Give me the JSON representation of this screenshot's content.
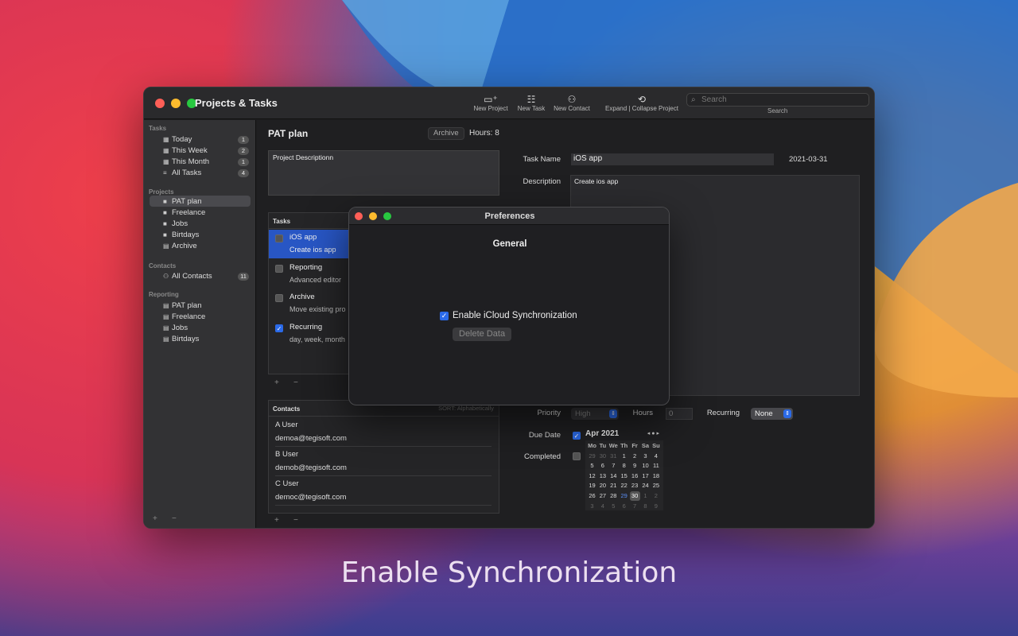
{
  "window": {
    "title": "Projects & Tasks"
  },
  "toolbar": {
    "new_project": "New Project",
    "new_task": "New Task",
    "new_contact": "New Contact",
    "expand_collapse": "Expand | Collapse Project",
    "search_placeholder": "Search",
    "search_label": "Search"
  },
  "sidebar": {
    "tasks_header": "Tasks",
    "tasks": [
      {
        "label": "Today",
        "count": "1"
      },
      {
        "label": "This Week",
        "count": "2"
      },
      {
        "label": "This Month",
        "count": "1"
      },
      {
        "label": "All Tasks",
        "count": "4"
      }
    ],
    "projects_header": "Projects",
    "projects": [
      {
        "label": "PAT plan"
      },
      {
        "label": "Freelance"
      },
      {
        "label": "Jobs"
      },
      {
        "label": "Birtdays"
      },
      {
        "label": "Archive"
      }
    ],
    "contacts_header": "Contacts",
    "contacts": [
      {
        "label": "All Contacts",
        "count": "11"
      }
    ],
    "reporting_header": "Reporting",
    "reporting": [
      {
        "label": "PAT plan"
      },
      {
        "label": "Freelance"
      },
      {
        "label": "Jobs"
      },
      {
        "label": "Birtdays"
      }
    ],
    "add": "+",
    "remove": "−"
  },
  "project": {
    "title": "PAT plan",
    "archive_button": "Archive",
    "hours": "Hours: 8",
    "description": "Project Descriptionn"
  },
  "tasks_panel": {
    "header": "Tasks",
    "items": [
      {
        "name": "iOS app",
        "sub": "Create ios app",
        "checked": false
      },
      {
        "name": "Reporting",
        "sub": "Advanced editor",
        "checked": false
      },
      {
        "name": "Archive",
        "sub": "Move existing pro",
        "checked": false
      },
      {
        "name": "Recurring",
        "sub": "day, week, month",
        "checked": true
      }
    ],
    "add": "+",
    "remove": "−"
  },
  "contacts_panel": {
    "header": "Contacts",
    "sort": "SORT: Alphabetically",
    "items": [
      {
        "name": "A User",
        "email": "demoa@tegisoft.com"
      },
      {
        "name": "B User",
        "email": "demob@tegisoft.com"
      },
      {
        "name": "C User",
        "email": "democ@tegisoft.com"
      }
    ],
    "add": "+",
    "remove": "−"
  },
  "task_detail": {
    "task_name_label": "Task Name",
    "task_name": "iOS app",
    "date": "2021-03-31",
    "description_label": "Description",
    "description": "Create ios app",
    "priority_label": "Priority",
    "priority": "High",
    "hours_label": "Hours",
    "hours": "0",
    "recurring_label": "Recurring",
    "recurring": "None",
    "due_date_label": "Due Date",
    "completed_label": "Completed"
  },
  "calendar": {
    "month": "Apr 2021",
    "weekdays": [
      "Mo",
      "Tu",
      "We",
      "Th",
      "Fr",
      "Sa",
      "Su"
    ],
    "days": [
      "29",
      "30",
      "31",
      "1",
      "2",
      "3",
      "4",
      "5",
      "6",
      "7",
      "8",
      "9",
      "10",
      "11",
      "12",
      "13",
      "14",
      "15",
      "16",
      "17",
      "18",
      "19",
      "20",
      "21",
      "22",
      "23",
      "24",
      "25",
      "26",
      "27",
      "28",
      "29",
      "30",
      "1",
      "2",
      "3",
      "4",
      "5",
      "6",
      "7",
      "8",
      "9"
    ]
  },
  "preferences": {
    "title": "Preferences",
    "section": "General",
    "icloud_label": "Enable iCloud Synchronization",
    "icloud_checked": true,
    "delete_button": "Delete Data"
  },
  "caption": "Enable Synchronization",
  "colors": {
    "accent": "#2b6ae8",
    "selection": "#2856c4"
  }
}
